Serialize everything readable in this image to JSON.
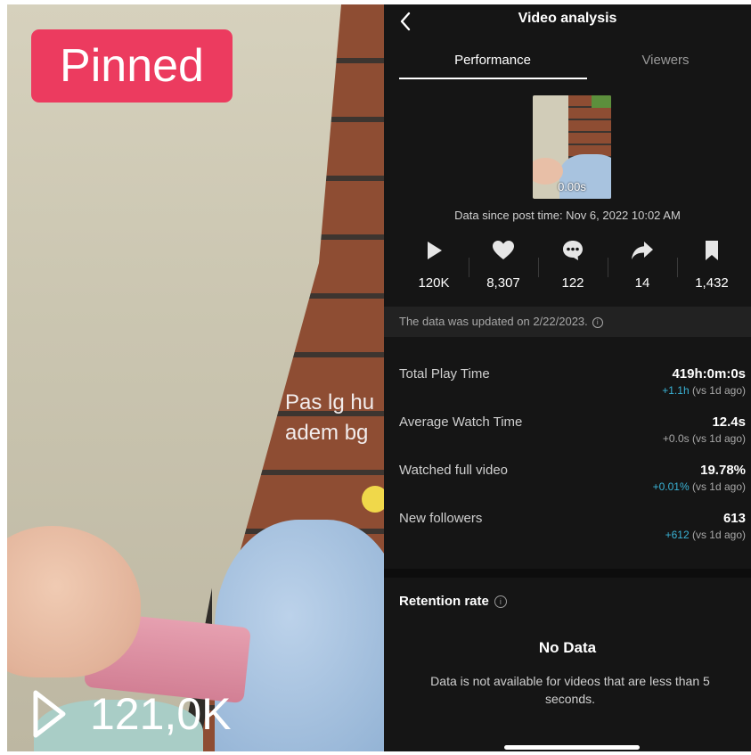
{
  "thumbnail": {
    "pinned_label": "Pinned",
    "caption_line1": "Pas lg hu",
    "caption_line2": "adem bg",
    "view_count": "121,0K"
  },
  "header": {
    "title": "Video analysis",
    "back_icon": "chevron-left-icon"
  },
  "tabs": [
    {
      "label": "Performance",
      "active": true
    },
    {
      "label": "Viewers",
      "active": false
    }
  ],
  "video": {
    "duration": "0.00s",
    "since_text": "Data since post time: Nov 6, 2022 10:02 AM"
  },
  "stats": [
    {
      "icon": "play-icon",
      "value": "120K"
    },
    {
      "icon": "heart-icon",
      "value": "8,307"
    },
    {
      "icon": "comment-icon",
      "value": "122"
    },
    {
      "icon": "share-icon",
      "value": "14"
    },
    {
      "icon": "bookmark-icon",
      "value": "1,432"
    }
  ],
  "updated_text": "The data was updated on 2/22/2023.",
  "metrics": [
    {
      "label": "Total Play Time",
      "value": "419h:0m:0s",
      "delta": "+1.1h",
      "delta_suffix": " (vs 1d ago)"
    },
    {
      "label": "Average Watch Time",
      "value": "12.4s",
      "delta": "+0.0s",
      "delta_suffix": " (vs 1d ago)"
    },
    {
      "label": "Watched full video",
      "value": "19.78%",
      "delta": "+0.01%",
      "delta_suffix": " (vs 1d ago)"
    },
    {
      "label": "New followers",
      "value": "613",
      "delta": "+612",
      "delta_suffix": " (vs 1d ago)"
    }
  ],
  "retention": {
    "title": "Retention rate",
    "nodata_title": "No Data",
    "nodata_message": "Data is not available for videos that are less than 5 seconds."
  },
  "colors": {
    "pinned_bg": "#ec3b5f",
    "panel_bg": "#151515",
    "delta_up": "#3ab3d6"
  }
}
